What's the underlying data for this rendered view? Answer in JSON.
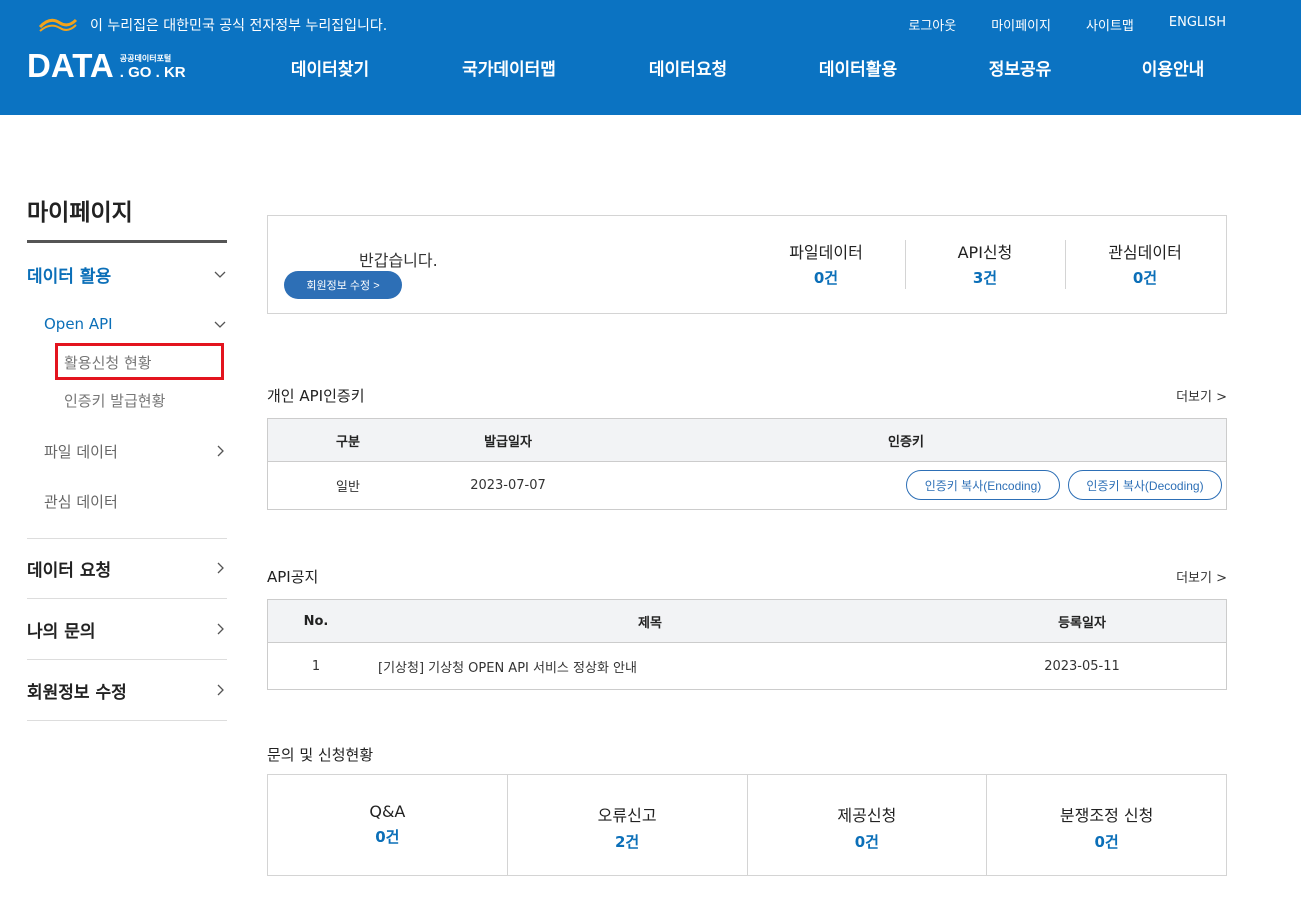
{
  "header": {
    "gov_notice": "이 누리집은 대한민국 공식 전자정부 누리집입니다.",
    "util_links": [
      "로그아웃",
      "마이페이지",
      "사이트맵",
      "ENGLISH"
    ],
    "brand": {
      "main": "DATA",
      "sub_top": "공공데이터포털",
      "sub_bottom": ". GO . KR"
    },
    "nav": [
      "데이터찾기",
      "국가데이터맵",
      "데이터요청",
      "데이터활용",
      "정보공유",
      "이용안내"
    ],
    "colors": {
      "header_bg": "#0b73c2",
      "accent": "#0b6fb8",
      "highlight": "#e3141e"
    }
  },
  "sidebar": {
    "title": "마이페이지",
    "data_use": "데이터 활용",
    "open_api": "Open API",
    "apply_status": "활용신청 현황",
    "key_status": "인증키 발급현황",
    "file_data": "파일 데이터",
    "interest_data": "관심 데이터",
    "data_request": "데이터 요청",
    "my_inquiry": "나의 문의",
    "member_edit": "회원정보 수정"
  },
  "welcome": {
    "greeting": "반갑습니다.",
    "edit_button": "회원정보 수정 >",
    "stats": [
      {
        "label": "파일데이터",
        "value": "0건"
      },
      {
        "label": "API신청",
        "value": "3건"
      },
      {
        "label": "관심데이터",
        "value": "0건"
      }
    ]
  },
  "api_key": {
    "title": "개인 API인증키",
    "more": "더보기 >",
    "headers": [
      "구분",
      "발급일자",
      "인증키"
    ],
    "row": {
      "type": "일반",
      "date": "2023-07-07"
    },
    "copy_encoding": "인증키 복사(Encoding)",
    "copy_decoding": "인증키 복사(Decoding)"
  },
  "api_notice": {
    "title": "API공지",
    "more": "더보기 >",
    "headers": [
      "No.",
      "제목",
      "등록일자"
    ],
    "row": {
      "no": "1",
      "subject": "[기상청] 기상청 OPEN API 서비스 정상화 안내",
      "date": "2023-05-11"
    }
  },
  "inquiry": {
    "title": "문의 및 신청현황",
    "items": [
      {
        "label": "Q&A",
        "value": "0건"
      },
      {
        "label": "오류신고",
        "value": "2건"
      },
      {
        "label": "제공신청",
        "value": "0건"
      },
      {
        "label": "분쟁조정 신청",
        "value": "0건"
      }
    ]
  }
}
